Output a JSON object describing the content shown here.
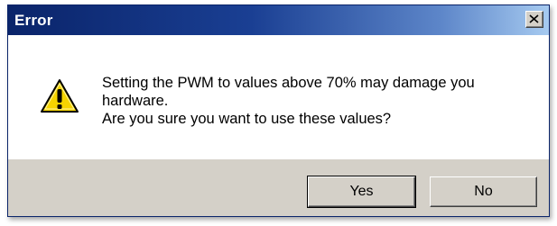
{
  "window": {
    "title": "Error",
    "close_icon": "close-icon"
  },
  "message": {
    "icon": "warning-icon",
    "line1": "Setting the PWM to values above 70% may damage you",
    "line2": "hardware.",
    "line3": "Are you sure you want to use these values?"
  },
  "buttons": {
    "yes_label": "Yes",
    "no_label": "No"
  },
  "colors": {
    "titlebar_start": "#0a246a",
    "titlebar_end": "#a6caf0",
    "dialog_face": "#d4d0c8",
    "warning_yellow": "#f5d400"
  }
}
